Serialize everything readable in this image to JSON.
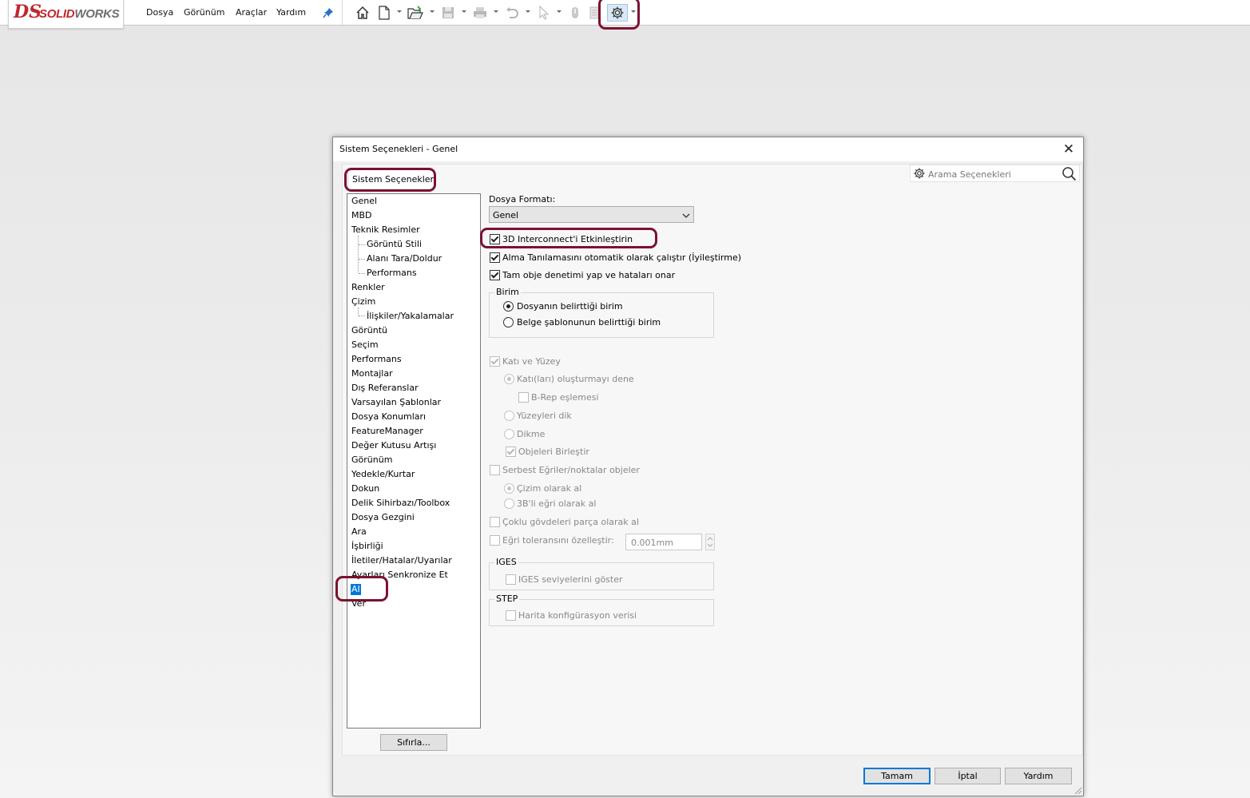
{
  "app": {
    "logo_ds": "DS",
    "logo_brand_bold": "SOLID",
    "logo_brand_rest": "WORKS",
    "menu": [
      "Dosya",
      "Görünüm",
      "Araçlar",
      "Yardım"
    ]
  },
  "toolbar": {
    "icons": [
      "pin-icon",
      "home-icon",
      "new-document-icon",
      "open-folder-icon",
      "save-icon",
      "print-icon",
      "undo-icon",
      "select-arrow-icon",
      "rebuild-icon",
      "file-properties-icon",
      "options-gear-icon"
    ]
  },
  "dialog": {
    "title": "Sistem Seçenekleri - Genel",
    "tab_label": "Sistem Seçenekleri",
    "search_placeholder": "Arama Seçenekleri",
    "tree": {
      "items": [
        "Genel",
        "MBD",
        "Teknik Resimler",
        "Görüntü Stili",
        "Alanı Tara/Doldur",
        "Performans",
        "Renkler",
        "Çizim",
        "İlişkiler/Yakalamalar",
        "Görüntü",
        "Seçim",
        "Performans",
        "Montajlar",
        "Dış Referanslar",
        "Varsayılan Şablonlar",
        "Dosya Konumları",
        "FeatureManager",
        "Değer Kutusu Artışı",
        "Görünüm",
        "Yedekle/Kurtar",
        "Dokun",
        "Delik Sihirbazı/Toolbox",
        "Dosya Gezgini",
        "Ara",
        "İşbirliği",
        "İletiler/Hatalar/Uyarılar",
        "Ayarları Senkronize Et",
        "AI",
        "Ver"
      ],
      "selected": "AI"
    },
    "reset_button": "Sıfırla...",
    "file_format_label": "Dosya Formatı:",
    "file_format_value": "Genel",
    "checks": {
      "interconnect": "3D Interconnect'i Etkinleştirin",
      "auto_diag": "Alma Tanılamasını otomatik olarak çalıştır (İyileştirme)",
      "full_check": "Tam obje denetimi yap ve hataları onar"
    },
    "unit_group": {
      "label": "Birim",
      "opt1": "Dosyanın belirttiği birim",
      "opt2": "Belge şablonunun belirttiği birim"
    },
    "solid_surface": {
      "label": "Katı ve Yüzey",
      "try_solid": "Katı(ları) oluşturmayı dene",
      "brep": "B-Rep eşlemesi",
      "knit": "Yüzeyleri dik",
      "no_knit": "Dikme",
      "merge": "Objeleri Birleştir"
    },
    "free_curves": {
      "label": "Serbest Eğriler/noktalar objeler",
      "as_sketch": "Çizim olarak al",
      "as_3d_curve": "3B'li eğri olarak al"
    },
    "multi_body": "Çoklu gövdeleri parça olarak al",
    "curve_tol": {
      "label": "Eğri toleransını özelleştir:",
      "value": "0.001mm"
    },
    "iges": {
      "label": "IGES",
      "show_levels": "IGES seviyelerini göster"
    },
    "step": {
      "label": "STEP",
      "map_config": "Harita konfigürasyon verisi"
    },
    "ok_button": "Tamam",
    "cancel_button": "İptal",
    "help_button": "Yardım"
  },
  "colors": {
    "highlight_ring": "#7b1230",
    "selection": "#0078d7",
    "brand": "#c1272d"
  }
}
